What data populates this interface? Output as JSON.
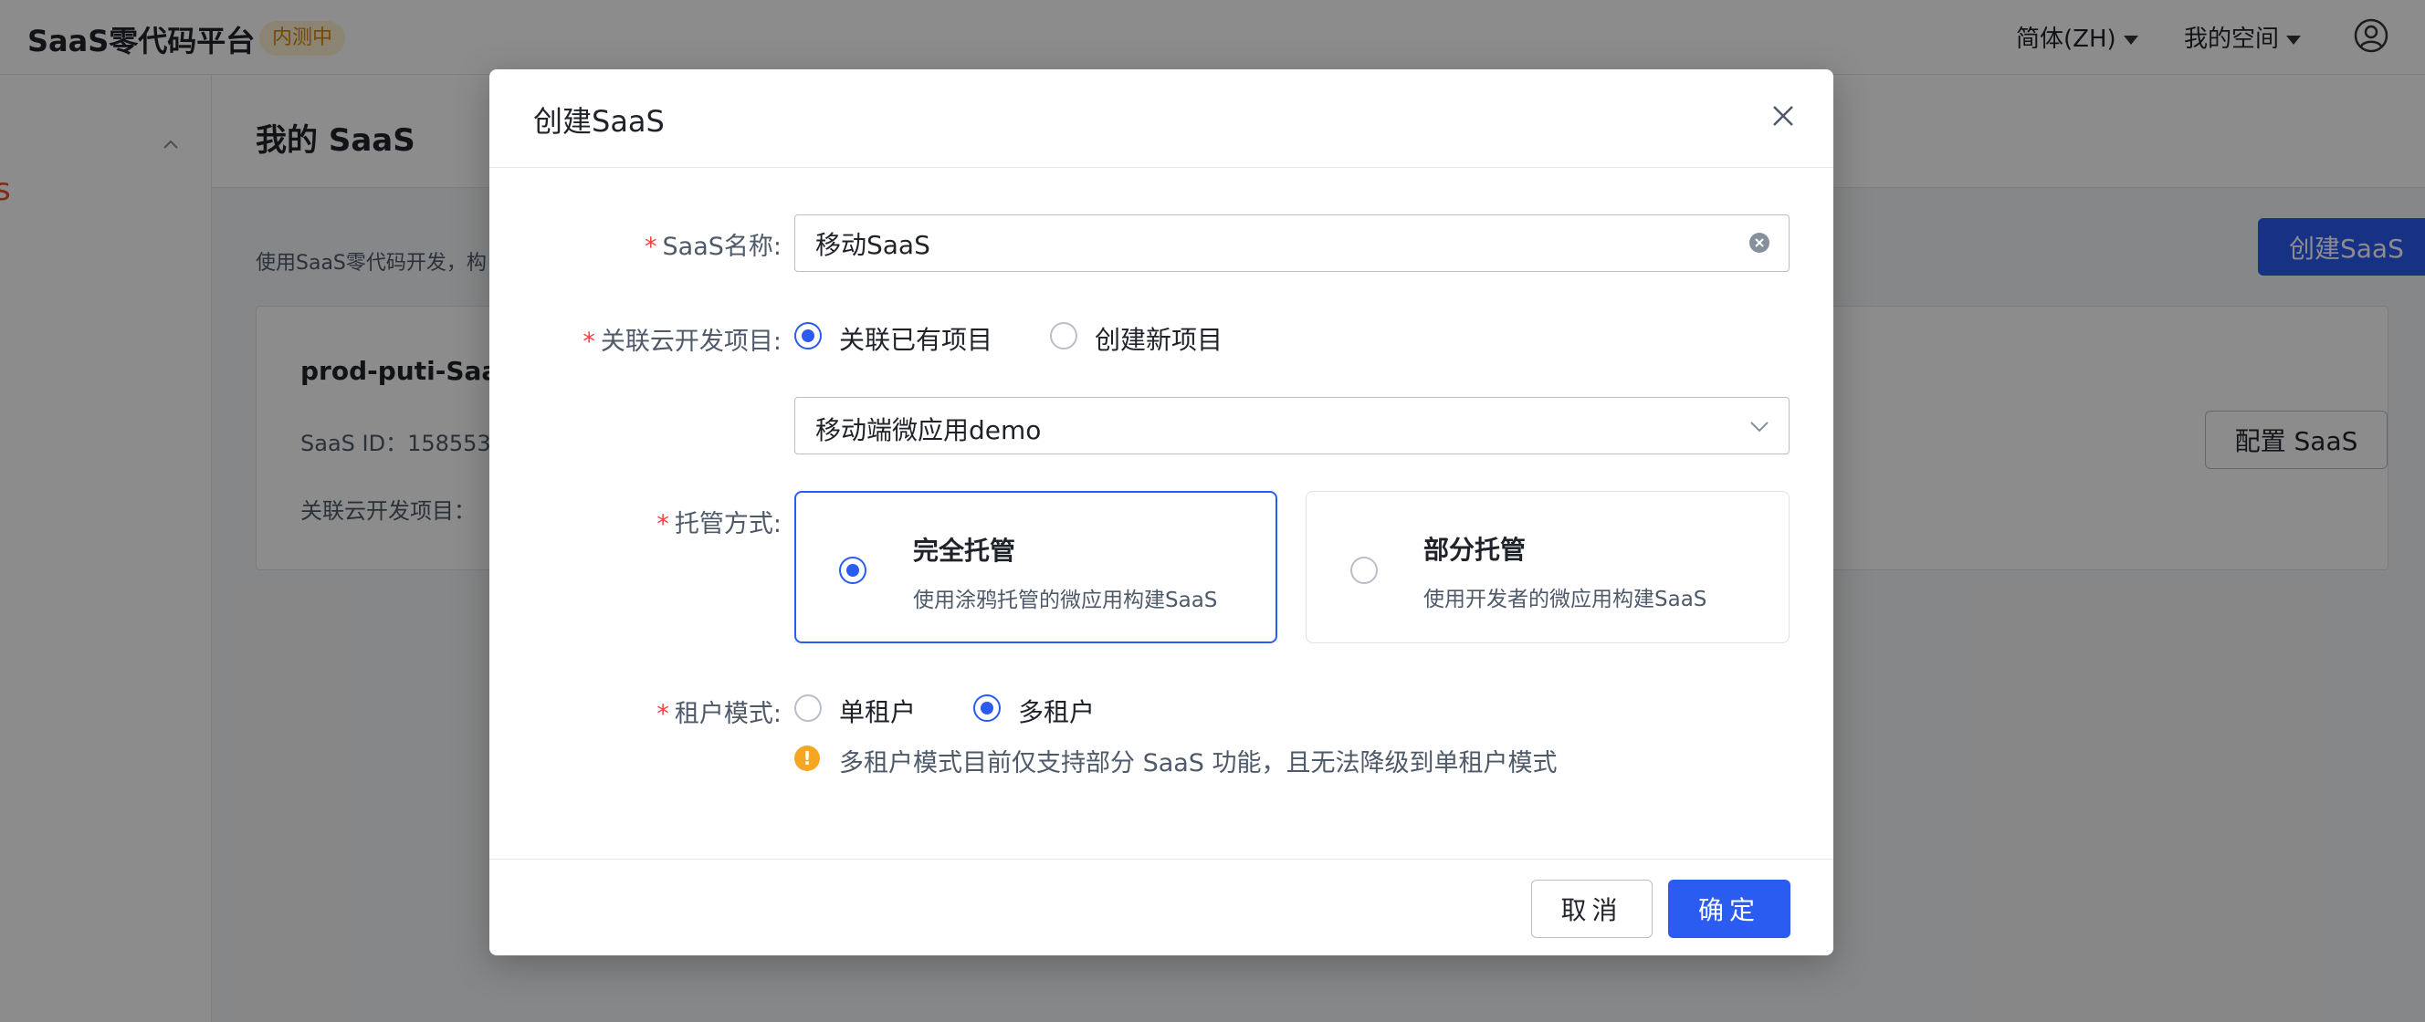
{
  "app": {
    "title": "SaaS零代码平台",
    "badge": "内测中",
    "language": "简体(ZH)",
    "space": "我的空间"
  },
  "sidebar": {
    "fragment": "s"
  },
  "main": {
    "page_title": "我的 SaaS",
    "description": "使用SaaS零代码开发，构",
    "create_button": "创建SaaS",
    "card": {
      "name": "prod-puti-Saa",
      "id_label": "SaaS ID：158553",
      "project_label": "关联云开发项目：",
      "config_button": "配置 SaaS"
    }
  },
  "modal": {
    "title": "创建SaaS",
    "name_field": {
      "label": "SaaS名称:",
      "value": "移动SaaS"
    },
    "project_field": {
      "label": "关联云开发项目:",
      "options": [
        "关联已有项目",
        "创建新项目"
      ],
      "selected_index": 0,
      "select_value": "移动端微应用demo"
    },
    "hosting_field": {
      "label": "托管方式:",
      "options": [
        {
          "title": "完全托管",
          "desc": "使用涂鸦托管的微应用构建SaaS"
        },
        {
          "title": "部分托管",
          "desc": "使用开发者的微应用构建SaaS"
        }
      ],
      "selected_index": 0
    },
    "tenant_field": {
      "label": "租户模式:",
      "options": [
        "单租户",
        "多租户"
      ],
      "selected_index": 1,
      "warning": "多租户模式目前仅支持部分 SaaS 功能，且无法降级到单租户模式"
    },
    "cancel_button": "取消",
    "ok_button": "确定"
  },
  "colors": {
    "primary": "#2b5cf2",
    "required": "#f53f3f",
    "warning": "#f5a623",
    "badge_bg": "#fdf0d2",
    "badge_text": "#d48806"
  }
}
